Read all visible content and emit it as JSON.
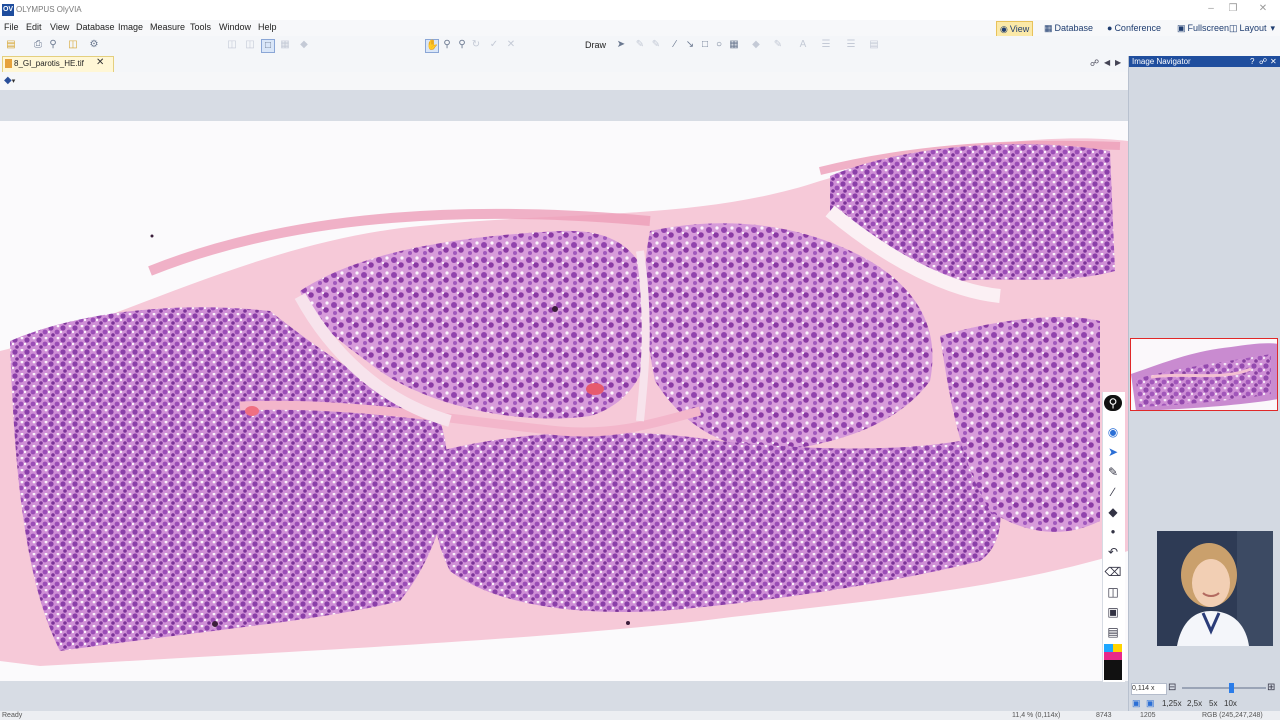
{
  "window": {
    "title": "OLYMPUS OlyVIA",
    "logo": "OV"
  },
  "menu": [
    "File",
    "Edit",
    "View",
    "Database",
    "Image",
    "Measure",
    "Tools",
    "Window",
    "Help"
  ],
  "toolbar": {
    "draw_label": "Draw"
  },
  "modes": [
    {
      "label": "View",
      "icon": "eye-icon"
    },
    {
      "label": "Database",
      "icon": "database-icon"
    },
    {
      "label": "Conference",
      "icon": "conference-icon"
    },
    {
      "label": "Fullscreen",
      "icon": "fullscreen-icon"
    },
    {
      "label": "Layout",
      "icon": "layout-icon"
    }
  ],
  "document_tab": {
    "label": "8_GI_parotis_HE.tif"
  },
  "navigator": {
    "title": "Image Navigator",
    "zoom_value": "0,114 x",
    "zoom_presets": [
      "1,25x",
      "2,5x",
      "5x",
      "10x"
    ]
  },
  "status": {
    "left": "Ready",
    "zoom": "11,4 % (0,114x)",
    "x": "8743",
    "y": "1205",
    "rgb": "RGB (245,247,248)"
  },
  "colors": {
    "accent": "#1f4e9e",
    "viewport_border": "#e02828",
    "active_mode": "#fbe9a8",
    "tissue_dark": "#8a3fa8",
    "tissue_light": "#c67ac6",
    "stroma": "#f0aec4"
  }
}
